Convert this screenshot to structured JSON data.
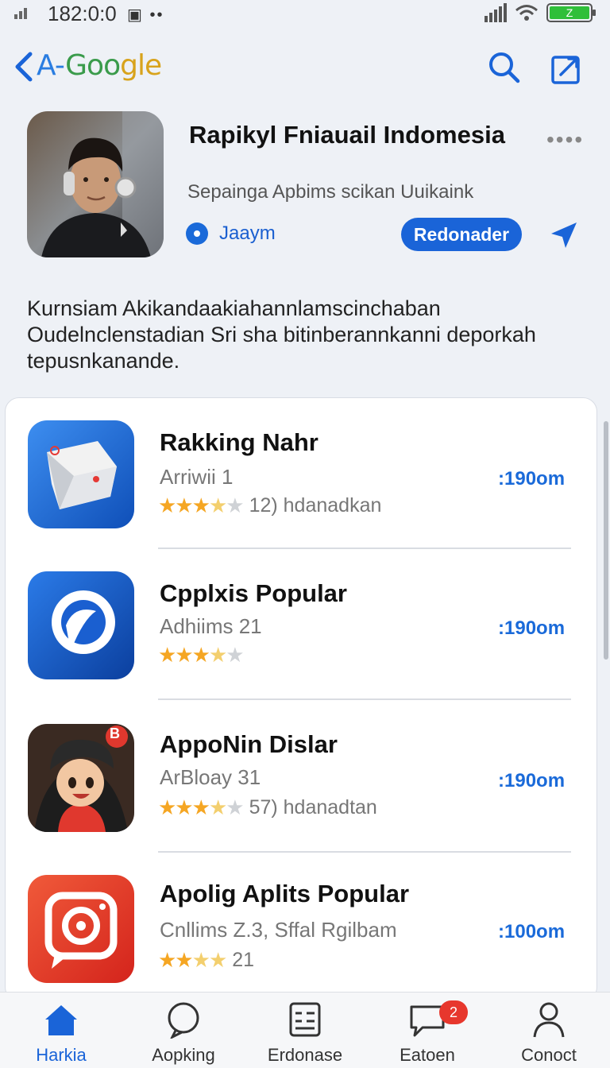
{
  "status_bar": {
    "time": "182:0:0",
    "battery_label": "Z"
  },
  "header": {
    "brand_part1": "A-",
    "brand_part2": "Goo",
    "brand_part3": "gle",
    "icons": [
      "back-chevron-icon",
      "search-icon",
      "share-icon"
    ]
  },
  "app": {
    "title": "Rapikyl Fniauail Indomesia",
    "subtitle": "Sepainga Apbims scikan Uuikaink",
    "developer": "Jaaym",
    "action_label": "Redonader",
    "description": "Kurnsiam Akikandaakiahannlamscinchaban Oudelnclenstadian Sri sha bitinberannkanni deporkah tepusnkanande."
  },
  "list": {
    "items": [
      {
        "name": "Rakking Nahr",
        "subtitle": "Arriwii 1",
        "stars_full": 3,
        "stars_half": 1,
        "rating_text": "12)  hdanadkan",
        "size": ":190om",
        "icon": "folder-app-icon"
      },
      {
        "name": "Cpplxis Popular",
        "subtitle": "Adhiims 21",
        "stars_full": 3,
        "stars_half": 1,
        "rating_text": "",
        "size": ":190om",
        "icon": "chat-bubble-app-icon"
      },
      {
        "name": "AppoNin Dislar",
        "subtitle": "ArBloay 31",
        "stars_full": 3,
        "stars_half": 1,
        "rating_text": "57)  hdanadtan",
        "size": ":190om",
        "icon": "cartoon-character-app-icon",
        "icon_badge": "B"
      },
      {
        "name": "Apolig Aplits Popular",
        "subtitle": "Cnllims Z.3, Sffal Rgilbam",
        "stars_full": 2,
        "stars_half": 1,
        "rating_text": "21",
        "size": ":100om",
        "icon": "camera-chat-app-icon"
      }
    ]
  },
  "tabs": [
    {
      "label": "Harkia",
      "icon": "home-icon",
      "active": true
    },
    {
      "label": "Aopking",
      "icon": "circle-icon",
      "active": false
    },
    {
      "label": "Erdonase",
      "icon": "list-icon",
      "active": false
    },
    {
      "label": "Eatoen",
      "icon": "message-icon",
      "active": false,
      "badge": "2"
    },
    {
      "label": "Conoct",
      "icon": "person-icon",
      "active": false
    }
  ],
  "colors": {
    "accent": "#1a64d8",
    "star": "#f5a623",
    "badge": "#e7372d",
    "battery": "#2fbf3a"
  }
}
